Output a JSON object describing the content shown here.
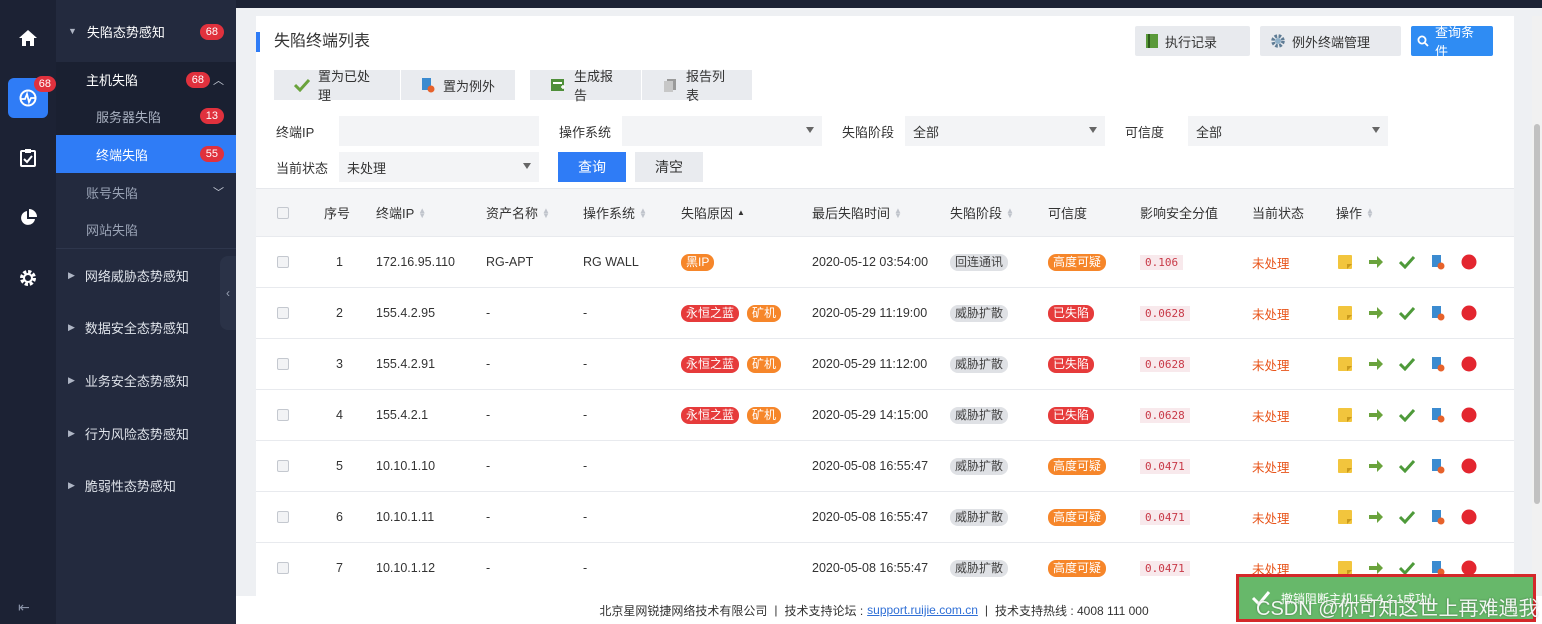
{
  "rail": {
    "active_badge": "68"
  },
  "menu": {
    "group_open": {
      "label": "失陷态势感知",
      "badge": "68"
    },
    "sub_open": {
      "label": "主机失陷",
      "badge": "68"
    },
    "leaves": [
      {
        "label": "服务器失陷",
        "badge": "13"
      },
      {
        "label": "终端失陷",
        "badge": "55"
      }
    ],
    "account": {
      "label": "账号失陷"
    },
    "website": {
      "label": "网站失陷"
    },
    "groups": [
      {
        "label": "网络威胁态势感知"
      },
      {
        "label": "数据安全态势感知"
      },
      {
        "label": "业务安全态势感知"
      },
      {
        "label": "行为风险态势感知"
      },
      {
        "label": "脆弱性态势感知"
      }
    ]
  },
  "panel": {
    "title": "失陷终端列表",
    "exec_record": "执行记录",
    "exception_mgmt": "例外终端管理",
    "query_conditions": "查询条件"
  },
  "actions": {
    "mark_handled": "置为已处理",
    "mark_exception": "置为例外",
    "gen_report": "生成报告",
    "report_list": "报告列表"
  },
  "filters": {
    "ip_label": "终端IP",
    "ip_value": "",
    "os_label": "操作系统",
    "os_value": "",
    "stage_label": "失陷阶段",
    "stage_value": "全部",
    "credibility_label": "可信度",
    "credibility_value": "全部",
    "status_label": "当前状态",
    "status_value": "未处理",
    "query": "查询",
    "clear": "清空"
  },
  "table": {
    "headers": {
      "index": "序号",
      "ip": "终端IP",
      "asset": "资产名称",
      "os": "操作系统",
      "reason": "失陷原因",
      "last_time": "最后失陷时间",
      "stage": "失陷阶段",
      "credibility": "可信度",
      "score": "影响安全分值",
      "status": "当前状态",
      "ops": "操作"
    },
    "rows": [
      {
        "index": "1",
        "ip": "172.16.95.110",
        "asset": "RG-APT",
        "os": "RG WALL",
        "reasons": [
          {
            "text": "黑IP",
            "color": "#f6862a"
          }
        ],
        "time": "2020-05-12 03:54:00",
        "stage": "回连通讯",
        "cred": "高度可疑",
        "cred_color": "#f6862a",
        "score": "0.106",
        "status": "未处理"
      },
      {
        "index": "2",
        "ip": "155.4.2.95",
        "asset": "-",
        "os": "-",
        "reasons": [
          {
            "text": "永恒之蓝",
            "color": "#e63b3b"
          },
          {
            "text": "矿机",
            "color": "#f6862a"
          }
        ],
        "time": "2020-05-29 11:19:00",
        "stage": "威胁扩散",
        "cred": "已失陷",
        "cred_color": "#e63b3b",
        "score": "0.0628",
        "status": "未处理"
      },
      {
        "index": "3",
        "ip": "155.4.2.91",
        "asset": "-",
        "os": "-",
        "reasons": [
          {
            "text": "永恒之蓝",
            "color": "#e63b3b"
          },
          {
            "text": "矿机",
            "color": "#f6862a"
          }
        ],
        "time": "2020-05-29 11:12:00",
        "stage": "威胁扩散",
        "cred": "已失陷",
        "cred_color": "#e63b3b",
        "score": "0.0628",
        "status": "未处理"
      },
      {
        "index": "4",
        "ip": "155.4.2.1",
        "asset": "-",
        "os": "-",
        "reasons": [
          {
            "text": "永恒之蓝",
            "color": "#e63b3b"
          },
          {
            "text": "矿机",
            "color": "#f6862a"
          }
        ],
        "time": "2020-05-29 14:15:00",
        "stage": "威胁扩散",
        "cred": "已失陷",
        "cred_color": "#e63b3b",
        "score": "0.0628",
        "status": "未处理"
      },
      {
        "index": "5",
        "ip": "10.10.1.10",
        "asset": "-",
        "os": "-",
        "reasons": [],
        "time": "2020-05-08 16:55:47",
        "stage": "威胁扩散",
        "cred": "高度可疑",
        "cred_color": "#f6862a",
        "score": "0.0471",
        "status": "未处理"
      },
      {
        "index": "6",
        "ip": "10.10.1.11",
        "asset": "-",
        "os": "-",
        "reasons": [],
        "time": "2020-05-08 16:55:47",
        "stage": "威胁扩散",
        "cred": "高度可疑",
        "cred_color": "#f6862a",
        "score": "0.0471",
        "status": "未处理"
      },
      {
        "index": "7",
        "ip": "10.10.1.12",
        "asset": "-",
        "os": "-",
        "reasons": [],
        "time": "2020-05-08 16:55:47",
        "stage": "威胁扩散",
        "cred": "高度可疑",
        "cred_color": "#f6862a",
        "score": "0.0471",
        "status": "未处理"
      }
    ]
  },
  "footer": {
    "company": "北京星网锐捷网络技术有限公司",
    "sep": "|",
    "forum_label": "技术支持论坛 :",
    "forum_link": "support.ruijie.com.cn",
    "hotline": "技术支持热线 : 4008 111 000"
  },
  "toast": {
    "message": "撤销阻断主机155.4.2.1成功！",
    "watermark": "CSDN @你可知这世上再难遇我"
  },
  "colors": {
    "accent": "#2f7cf6",
    "sidebar": "#1c2234",
    "badge": "#e0313d",
    "status_text": "#e8551b"
  }
}
